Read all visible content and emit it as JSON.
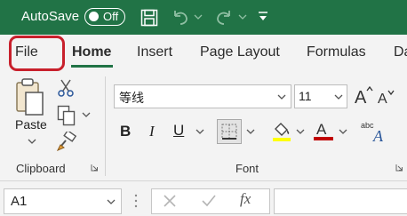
{
  "titlebar": {
    "autosave_label": "AutoSave",
    "autosave_state": "Off",
    "brand_color": "#217346"
  },
  "tabs": [
    {
      "label": "File"
    },
    {
      "label": "Home"
    },
    {
      "label": "Insert"
    },
    {
      "label": "Page Layout"
    },
    {
      "label": "Formulas"
    },
    {
      "label": "Da"
    }
  ],
  "ribbon": {
    "clipboard": {
      "group_label": "Clipboard",
      "paste_label": "Paste"
    },
    "font": {
      "group_label": "Font",
      "font_name": "等线",
      "font_size": "11",
      "bold_label": "B",
      "italic_label": "I",
      "underline_label": "U",
      "fill_color": "#ffff00",
      "font_color": "#c00000"
    }
  },
  "formula_bar": {
    "name_box": "A1",
    "fx_label": "fx",
    "formula": ""
  },
  "highlight": {
    "target": "File",
    "color": "#c8202c"
  }
}
